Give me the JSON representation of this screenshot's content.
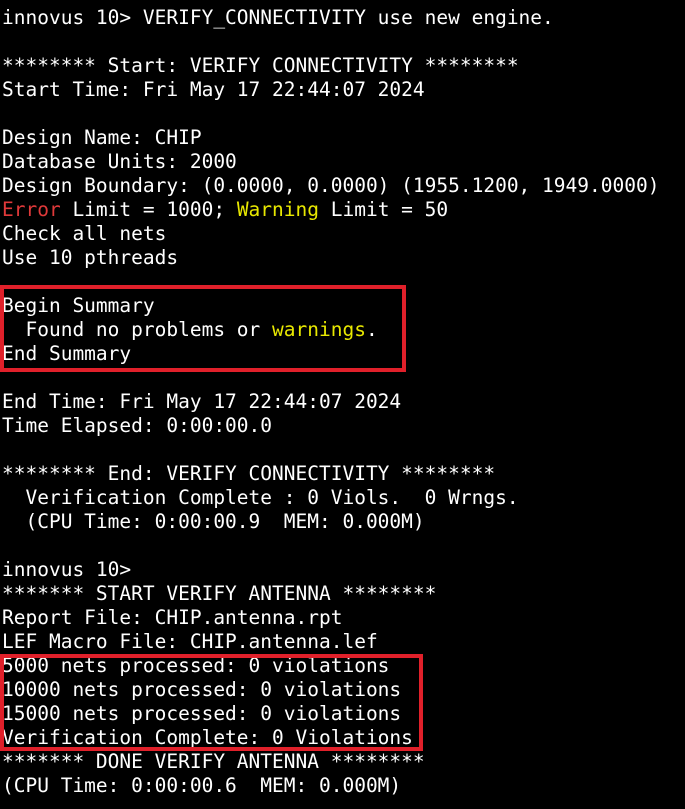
{
  "terminal": {
    "lines": [
      [
        {
          "t": "innovus 10> VERIFY_CONNECTIVITY use new engine."
        }
      ],
      [
        {
          "t": ""
        }
      ],
      [
        {
          "t": "******** Start: VERIFY CONNECTIVITY ********"
        }
      ],
      [
        {
          "t": "Start Time: Fri May 17 22:44:07 2024"
        }
      ],
      [
        {
          "t": ""
        }
      ],
      [
        {
          "t": "Design Name: CHIP"
        }
      ],
      [
        {
          "t": "Database Units: 2000"
        }
      ],
      [
        {
          "t": "Design Boundary: (0.0000, 0.0000) (1955.1200, 1949.0000)"
        }
      ],
      [
        {
          "t": "Error",
          "c": "red"
        },
        {
          "t": " Limit = 1000; "
        },
        {
          "t": "Warning",
          "c": "yellow"
        },
        {
          "t": " Limit = 50"
        }
      ],
      [
        {
          "t": "Check all nets"
        }
      ],
      [
        {
          "t": "Use 10 pthreads"
        }
      ],
      [
        {
          "t": ""
        }
      ],
      [
        {
          "t": "Begin Summary"
        }
      ],
      [
        {
          "t": "  Found no problems or "
        },
        {
          "t": "warnings",
          "c": "yellow"
        },
        {
          "t": "."
        }
      ],
      [
        {
          "t": "End Summary"
        }
      ],
      [
        {
          "t": ""
        }
      ],
      [
        {
          "t": "End Time: Fri May 17 22:44:07 2024"
        }
      ],
      [
        {
          "t": "Time Elapsed: 0:00:00.0"
        }
      ],
      [
        {
          "t": ""
        }
      ],
      [
        {
          "t": "******** End: VERIFY CONNECTIVITY ********"
        }
      ],
      [
        {
          "t": "  Verification Complete : 0 Viols.  0 Wrngs."
        }
      ],
      [
        {
          "t": "  (CPU Time: 0:00:00.9  MEM: 0.000M)"
        }
      ],
      [
        {
          "t": ""
        }
      ],
      [
        {
          "t": "innovus 10>"
        }
      ],
      [
        {
          "t": "******* START VERIFY ANTENNA ********"
        }
      ],
      [
        {
          "t": "Report File: CHIP.antenna.rpt"
        }
      ],
      [
        {
          "t": "LEF Macro File: CHIP.antenna.lef"
        }
      ],
      [
        {
          "t": "5000 nets processed: 0 violations"
        }
      ],
      [
        {
          "t": "10000 nets processed: 0 violations"
        }
      ],
      [
        {
          "t": "15000 nets processed: 0 violations"
        }
      ],
      [
        {
          "t": "Verification Complete: 0 Violations"
        }
      ],
      [
        {
          "t": "******* DONE VERIFY ANTENNA ********"
        }
      ],
      [
        {
          "t": "(CPU Time: 0:00:00.6  MEM: 0.000M)"
        }
      ]
    ]
  },
  "colors": {
    "background": "#000000",
    "text": "#ffffff",
    "error": "#e0393a",
    "warning": "#e8e800",
    "highlight_box": "#e0202a"
  }
}
